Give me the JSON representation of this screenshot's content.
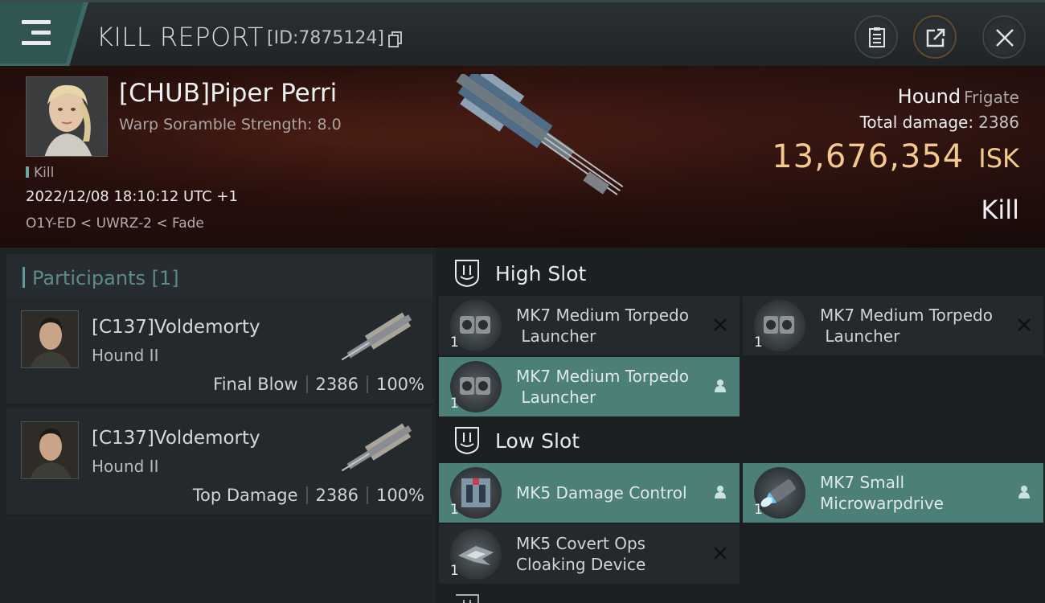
{
  "header": {
    "title": "KILL REPORT",
    "report_id": "[ID:7875124]",
    "icons": [
      "menu-icon",
      "copy-icon",
      "report-icon",
      "share-icon",
      "close-icon"
    ]
  },
  "victim": {
    "name": "[CHUB]Piper Perri",
    "scramble": "Warp Soramble Strength: 8.0",
    "kill_tag": "Kill",
    "datetime": "2022/12/08 18:10:12 UTC +1",
    "location": "O1Y-ED < UWRZ-2 < Fade",
    "ship_name": "Hound",
    "ship_class": "Frigate",
    "total_damage_label": "Total damage:",
    "total_damage": "2386",
    "isk_value": "13,676,354",
    "isk_unit": "ISK",
    "result": "Kill"
  },
  "participants": {
    "header": "Participants [1]",
    "items": [
      {
        "name": "[C137]Voldemorty",
        "ship": "Hound II",
        "role": "Final Blow",
        "damage": "2386",
        "percent": "100%"
      },
      {
        "name": "[C137]Voldemorty",
        "ship": "Hound II",
        "role": "Top Damage",
        "damage": "2386",
        "percent": "100%"
      }
    ]
  },
  "fitting": {
    "high_slot_label": "High Slot",
    "low_slot_label": "Low Slot",
    "high": [
      {
        "line1": "MK7 Medium Torpedo",
        "line2": " Launcher",
        "qty": "1",
        "status": "destroyed"
      },
      {
        "line1": "MK7 Medium Torpedo",
        "line2": " Launcher",
        "qty": "1",
        "status": "destroyed"
      },
      {
        "line1": "MK7 Medium Torpedo",
        "line2": " Launcher",
        "qty": "1",
        "status": "dropped"
      }
    ],
    "low": [
      {
        "line1": "MK5 Damage Control",
        "line2": "",
        "qty": "1",
        "status": "dropped"
      },
      {
        "line1": "MK7 Small",
        "line2": "Microwarpdrive",
        "qty": "1",
        "status": "dropped"
      },
      {
        "line1": "MK5 Covert Ops",
        "line2": "Cloaking Device",
        "qty": "1",
        "status": "destroyed"
      }
    ]
  },
  "colors": {
    "accent_teal": "#4c7f78",
    "isk_gold": "#f3c98d",
    "banner_red": "#6a2a1c"
  }
}
